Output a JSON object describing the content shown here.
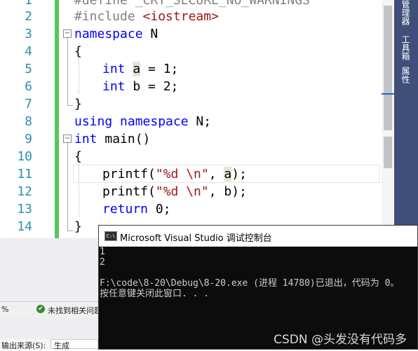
{
  "editor": {
    "line_numbers": [
      "1",
      "2",
      "3",
      "4",
      "5",
      "6",
      "7",
      "8",
      "9",
      "10",
      "11",
      "12",
      "13",
      "14"
    ],
    "lines": {
      "l1_pp": "#define _CRT_SECURE_NO_WARNINGS",
      "l2_pp": "#include ",
      "l2_inc": "<iostream>",
      "l3_kw": "namespace",
      "l3_rest": " N",
      "l4": "{",
      "l5_kw": "int",
      "l5_var": "a",
      "l5_rest": " = 1;",
      "l6_kw": "int",
      "l6_rest": " b = 2;",
      "l7": "}",
      "l8_kw": "using namespace",
      "l8_rest": " N;",
      "l9_kw": "int",
      "l9_rest": " main()",
      "l10": "{",
      "l11_fn": "printf(",
      "l11_str": "\"%d \\n\"",
      "l11_sep": ", ",
      "l11_var": "a",
      "l11_end": ");",
      "l12_fn": "printf(",
      "l12_str": "\"%d \\n\"",
      "l12_rest": ", b);",
      "l13_kw": "return",
      "l13_rest": " 0;",
      "l14": "}"
    },
    "fold_symbol": "−"
  },
  "right_panel": {
    "tabs": [
      "管理器",
      "工具箱",
      "属性"
    ]
  },
  "status": {
    "zoom": "%",
    "issues_text": "未找到相关问题"
  },
  "output": {
    "source_label": "输出来源(S):",
    "source_value": "生成"
  },
  "console": {
    "app_icon_text": "C:\\",
    "title": "Microsoft Visual Studio 调试控制台",
    "lines": [
      "1",
      "2",
      "",
      "F:\\code\\8-20\\Debug\\8-20.exe (进程 14780)已退出，代码为 0。",
      "按任意键关闭此窗口. . ."
    ]
  },
  "watermark": "CSDN @头发没有代码多",
  "colors": {
    "keyword": "#0000ff",
    "string": "#a31515",
    "preprocessor": "#808080",
    "line_number": "#2b91af",
    "change_bar": "#57c65a",
    "side_panel": "#3f4f7a",
    "console_bg": "#0c0c0c"
  }
}
